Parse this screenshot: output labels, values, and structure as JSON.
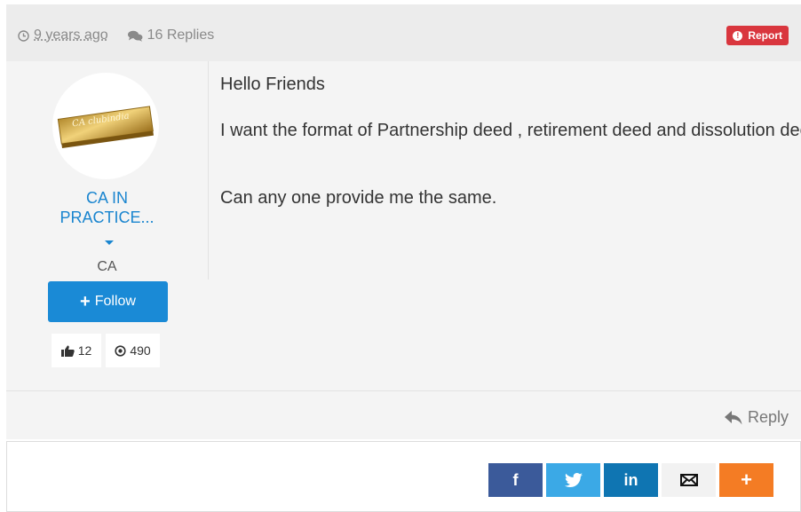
{
  "header": {
    "time_ago": "9 years ago",
    "replies": "16 Replies",
    "report_label": "Report"
  },
  "author": {
    "avatar_text": "CA clubindia",
    "name_line1": "CA IN",
    "name_line2": "PRACTICE...",
    "role": "CA",
    "follow_label": "Follow",
    "likes": "12",
    "views": "490"
  },
  "post": {
    "greeting": "Hello Friends",
    "paragraph1": "I want the format of Partnership deed , retirement deed and dissolution deeds",
    "paragraph2": "Can any one provide me the same."
  },
  "actions": {
    "reply_label": "Reply"
  },
  "share": {
    "facebook_glyph": "f",
    "linkedin_glyph": "in",
    "more_glyph": "+"
  },
  "colors": {
    "link_blue": "#1a85cf",
    "follow_blue": "#1a8ad6",
    "report_red": "#d9363e",
    "facebook": "#3b5a9a",
    "twitter": "#3ba9e6",
    "linkedin": "#0f75b2",
    "more_orange": "#f47c24"
  },
  "icons": [
    "clock-icon",
    "comments-icon",
    "exclamation-icon",
    "plus-icon",
    "thumbs-up-icon",
    "eye-icon",
    "reply-icon",
    "facebook-icon",
    "twitter-icon",
    "linkedin-icon",
    "email-icon",
    "more-icon"
  ]
}
